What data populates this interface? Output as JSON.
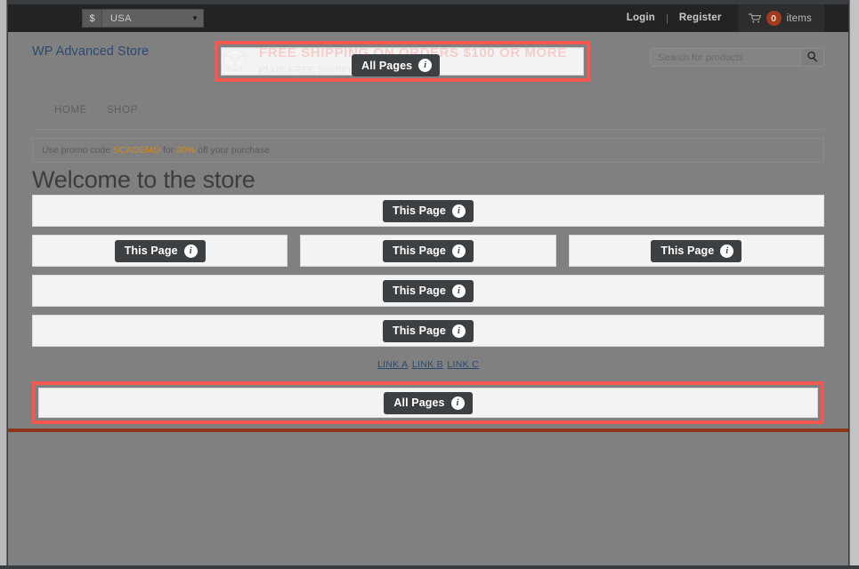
{
  "topbar": {
    "currency": {
      "symbol": "$",
      "value": "USA",
      "caret": "chevron-down-icon"
    },
    "login": "Login",
    "separator": "|",
    "register": "Register",
    "cart": {
      "count": "0",
      "label": "items",
      "icon": "cart-icon"
    }
  },
  "header": {
    "logo": "WP Advanced Store",
    "banner": {
      "line1": "FREE SHIPPING ON ORDERS $100 OR MORE",
      "line2": "PLUS FREE SHIPPING ON CLOTHES",
      "icon": "package-box-icon"
    },
    "search": {
      "placeholder": "Search for products",
      "value": "",
      "button_icon": "search-icon"
    }
  },
  "nav": {
    "items": [
      {
        "label": "HOME"
      },
      {
        "label": "SHOP"
      }
    ]
  },
  "promo": {
    "prefix": "Use promo code",
    "code": "SCADEMO",
    "middle": "for",
    "percent": "30%",
    "suffix": "off your purchase"
  },
  "main": {
    "title": "Welcome to the store",
    "badges": {
      "all_pages": "All Pages",
      "this_page": "This Page",
      "info_glyph": "i"
    },
    "rows": [
      {
        "type": "single",
        "badge": "This Page"
      },
      {
        "type": "triple",
        "badges": [
          "This Page",
          "This Page",
          "This Page"
        ]
      },
      {
        "type": "single",
        "badge": "This Page"
      },
      {
        "type": "single",
        "badge": "This Page"
      }
    ],
    "links": [
      {
        "label": "LINK A"
      },
      {
        "label": "LINK B"
      },
      {
        "label": "LINK C"
      }
    ],
    "footer_badge": "All Pages"
  },
  "colors": {
    "highlight": "#f4584f",
    "badge_bg": "#3c4043",
    "accent": "#cf8a1c",
    "link": "#2b4a72",
    "separator": "#8c3318",
    "page_bg": "#808080",
    "topbar_bg": "#232323"
  }
}
